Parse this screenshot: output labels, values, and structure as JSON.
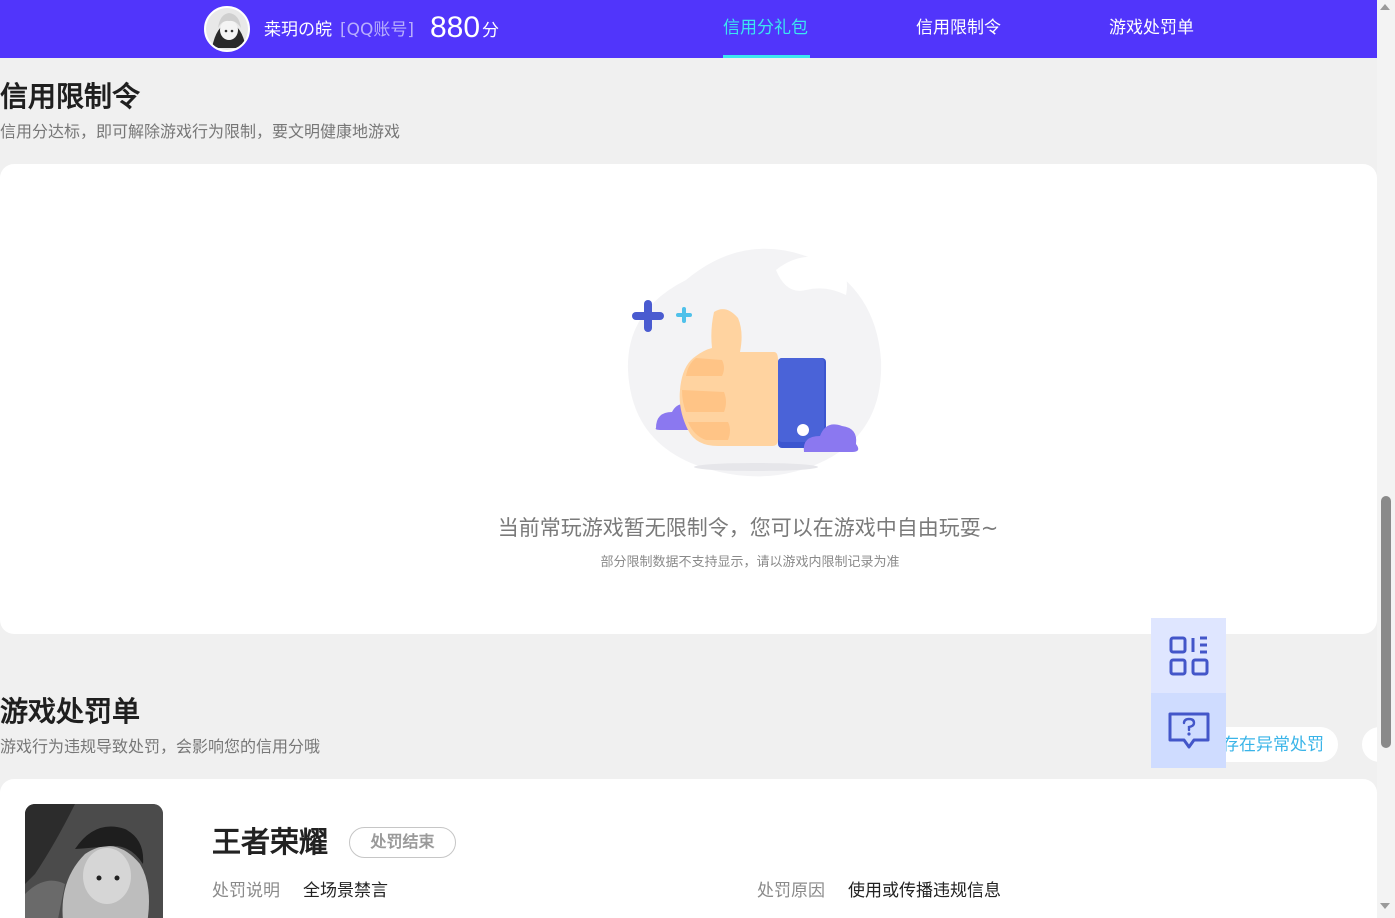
{
  "header": {
    "username": "桒玥の皖",
    "account_type": "[QQ账号]",
    "score": "880",
    "score_unit": "分",
    "tabs": [
      {
        "label": "信用分礼包",
        "active": true
      },
      {
        "label": "信用限制令",
        "active": false
      },
      {
        "label": "游戏处罚单",
        "active": false
      }
    ],
    "accent_color": "#5135fb",
    "active_tab_color": "#3ce6f0"
  },
  "restriction_section": {
    "title": "信用限制令",
    "subtitle": "信用分达标，即可解除游戏行为限制，要文明健康地游戏",
    "empty_message": "当前常玩游戏暂无限制令，您可以在游戏中自由玩耍~",
    "empty_note": "部分限制数据不支持显示，请以游戏内限制记录为准",
    "illustration_icon": "thumbs-up-icon"
  },
  "penalty_section": {
    "title": "游戏处罚单",
    "subtitle": "游戏行为违规导致处罚，会影响您的信用分哦",
    "anomaly_link": "存在异常处罚",
    "items": [
      {
        "game": "王者荣耀",
        "status": "处罚结束",
        "desc_label": "处罚说明",
        "desc_value": "全场景禁言",
        "reason_label": "处罚原因",
        "reason_value": "使用或传播违规信息"
      }
    ]
  },
  "floating": {
    "qr_icon": "qr-code-icon",
    "help_icon": "help-chat-icon"
  }
}
